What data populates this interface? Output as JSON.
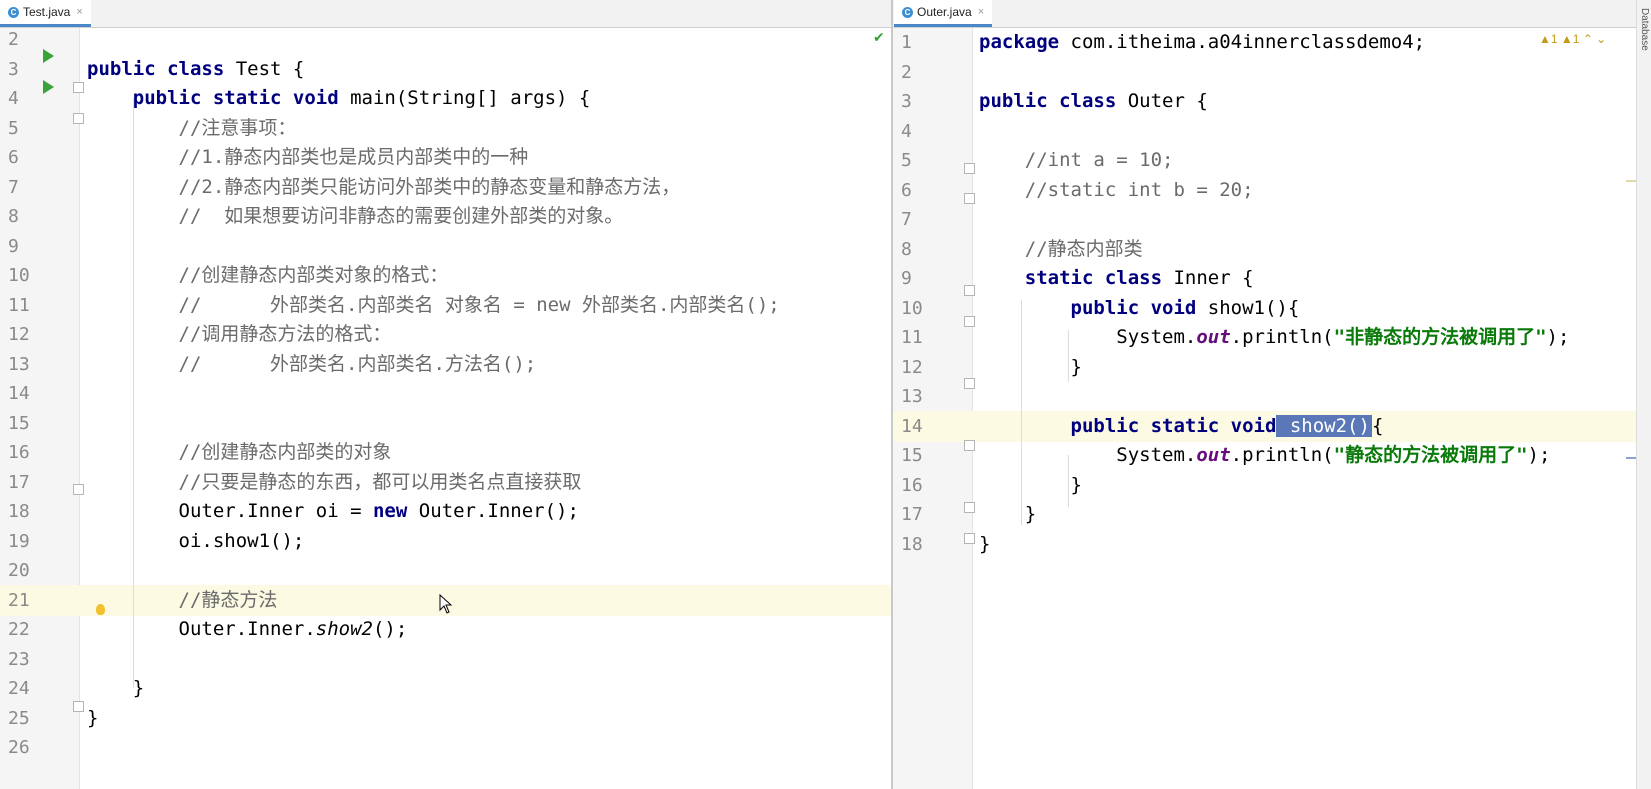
{
  "left_editor": {
    "tab": {
      "label": "Test.java",
      "close": "×"
    },
    "lines": [
      {
        "n": "2",
        "html": ""
      },
      {
        "n": "3",
        "html": "<span class=\"kw\">public class</span> Test {"
      },
      {
        "n": "4",
        "html": "    <span class=\"kw\">public static void</span> main(String[] args) {"
      },
      {
        "n": "5",
        "html": "        <span class=\"cm\">//注意事项：</span>"
      },
      {
        "n": "6",
        "html": "        <span class=\"cm\">//1.静态内部类也是成员内部类中的一种</span>"
      },
      {
        "n": "7",
        "html": "        <span class=\"cm\">//2.静态内部类只能访问外部类中的静态变量和静态方法，</span>"
      },
      {
        "n": "8",
        "html": "        <span class=\"cm\">//  如果想要访问非静态的需要创建外部类的对象。</span>"
      },
      {
        "n": "9",
        "html": ""
      },
      {
        "n": "10",
        "html": "        <span class=\"cm\">//创建静态内部类对象的格式：</span>"
      },
      {
        "n": "11",
        "html": "        <span class=\"cm\">//      外部类名.内部类名 对象名 = new 外部类名.内部类名();</span>"
      },
      {
        "n": "12",
        "html": "        <span class=\"cm\">//调用静态方法的格式：</span>"
      },
      {
        "n": "13",
        "html": "        <span class=\"cm\">//      外部类名.内部类名.方法名();</span>"
      },
      {
        "n": "14",
        "html": ""
      },
      {
        "n": "15",
        "html": ""
      },
      {
        "n": "16",
        "html": "        <span class=\"cm\">//创建静态内部类的对象</span>"
      },
      {
        "n": "17",
        "html": "        <span class=\"cm\">//只要是静态的东西，都可以用类名点直接获取</span>"
      },
      {
        "n": "18",
        "html": "        Outer.Inner oi = <span class=\"kw\">new</span> Outer.Inner();"
      },
      {
        "n": "19",
        "html": "        oi.show1();"
      },
      {
        "n": "20",
        "html": ""
      },
      {
        "n": "21",
        "html": "        <span class=\"cm\">//静态方法</span>"
      },
      {
        "n": "22",
        "html": "        Outer.Inner.<span class=\"itm\">show2</span>();"
      },
      {
        "n": "23",
        "html": ""
      },
      {
        "n": "24",
        "html": "    }"
      },
      {
        "n": "25",
        "html": "}"
      },
      {
        "n": "26",
        "html": ""
      }
    ]
  },
  "right_editor": {
    "tab": {
      "label": "Outer.java",
      "close": "×"
    },
    "warnings": "▲1  ▲1  ⌃  ⌄",
    "side_label": "Database",
    "lines": [
      {
        "n": "1",
        "html": "<span class=\"kw\">package</span> com.itheima.a04innerclassdemo4;"
      },
      {
        "n": "2",
        "html": ""
      },
      {
        "n": "3",
        "html": "<span class=\"kw\">public class</span> Outer {"
      },
      {
        "n": "4",
        "html": ""
      },
      {
        "n": "5",
        "html": "    <span class=\"cm\">//int a = 10;</span>"
      },
      {
        "n": "6",
        "html": "    <span class=\"cm\">//static int b = 20;</span>"
      },
      {
        "n": "7",
        "html": ""
      },
      {
        "n": "8",
        "html": "    <span class=\"cm\">//静态内部类</span>"
      },
      {
        "n": "9",
        "html": "    <span class=\"kw\">static class</span> Inner {"
      },
      {
        "n": "10",
        "html": "        <span class=\"kw\">public void</span> show1(){"
      },
      {
        "n": "11",
        "html": "            System.<span class=\"it\">out</span>.println(<span class=\"str\">\"非静态的方法被调用了\"</span>);"
      },
      {
        "n": "12",
        "html": "        }"
      },
      {
        "n": "13",
        "html": ""
      },
      {
        "n": "14",
        "html": "        <span class=\"kw\">public static void</span><span class=\"sel\"> show2()</span>{"
      },
      {
        "n": "15",
        "html": "            System.<span class=\"it\">out</span>.println(<span class=\"str\">\"静态的方法被调用了\"</span>);"
      },
      {
        "n": "16",
        "html": "        }"
      },
      {
        "n": "17",
        "html": "    }"
      },
      {
        "n": "18",
        "html": "}"
      }
    ]
  }
}
